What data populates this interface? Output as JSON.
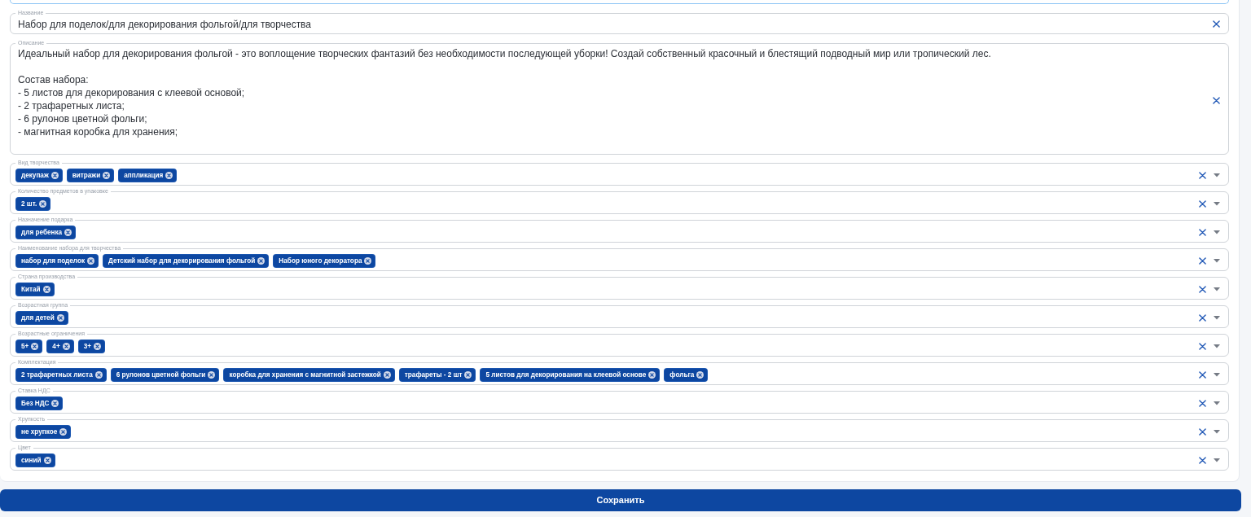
{
  "top_field": {
    "focused": true
  },
  "name_field": {
    "label": "Название",
    "value": "Набор для поделок/для декорирования фольгой/для творчества"
  },
  "description_field": {
    "label": "Описание",
    "value": "Идеальный набор для декорирования фольгой - это воплощение творческих фантазий без необходимости последующей уборки! Создай собственный красочный и блестящий подводный мир или тропический лес.\n\nСостав набора:\n- 5 листов для декорирования с клеевой основой;\n- 2 трафаретных листа;\n- 6 рулонов цветной фольги;\n- магнитная коробка для хранения;"
  },
  "select_fields": [
    {
      "label": "Вид творчества",
      "chips": [
        "декупаж",
        "витражи",
        "аппликация"
      ]
    },
    {
      "label": "Количество предметов в упаковке",
      "chips": [
        "2 шт."
      ]
    },
    {
      "label": "Назначение подарка",
      "chips": [
        "для ребенка"
      ]
    },
    {
      "label": "Наименование набора для творчества",
      "chips": [
        "набор для поделок",
        "Детский набор для декорирования фольгой",
        "Набор юного декоратора"
      ]
    },
    {
      "label": "Страна производства",
      "chips": [
        "Китай"
      ]
    },
    {
      "label": "Возрастная группа",
      "chips": [
        "для детей"
      ]
    },
    {
      "label": "Возрастные ограничения",
      "chips": [
        "5+",
        "4+",
        "3+"
      ]
    },
    {
      "label": "Комплектация",
      "chips": [
        "2 трафаретных листа",
        "6 рулонов цветной фольги",
        "коробка для хранения с магнитной застежкой",
        "трафареты - 2 шт",
        "5 листов для декорирования на клеевой основе",
        "фольга"
      ]
    },
    {
      "label": "Ставка НДС",
      "chips": [
        "Без НДС"
      ]
    },
    {
      "label": "Хрупкость",
      "chips": [
        "не хрупкое"
      ]
    },
    {
      "label": "Цвет",
      "chips": [
        "синий"
      ]
    }
  ],
  "save_button": {
    "label": "Сохранить"
  }
}
